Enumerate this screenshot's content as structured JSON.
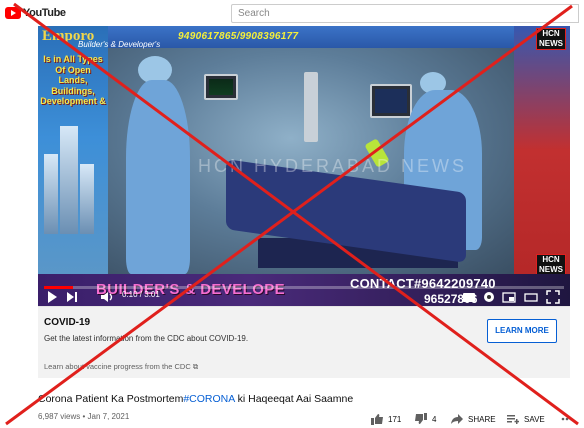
{
  "header": {
    "logo_text": "YouTube",
    "search_placeholder": "Search"
  },
  "video": {
    "ad_brand": "Emporo",
    "ad_brand_sub": "Builder's & Developer's",
    "ad_left_text": "Is in All Types Of Open Lands, Buildings, Development &",
    "top_phones": "9490617865/9908396177",
    "channel_logo": "HCN NEWS",
    "watermark": "HCN HYDERABAD NEWS",
    "lower_band_text": "BUILDER'S & DEVELOPE",
    "contact_line": "CONTACT#9642209740",
    "contact_line2": "96527806",
    "time_display": "0:10 / 3:01",
    "progress_fraction": 0.055
  },
  "info_panel": {
    "title": "COVID-19",
    "body": "Get the latest information from the CDC about COVID-19.",
    "button": "LEARN MORE",
    "link": "Learn about vaccine progress from the CDC ⧉"
  },
  "title": {
    "before": "Corona Patient Ka Postmortem",
    "hashtag": "#CORONA",
    "after": " ki Haqeeqat Aai Saamne"
  },
  "meta": {
    "views_date": "6,987 views • Jan 7, 2021"
  },
  "actions": {
    "likes": "171",
    "dislikes": "4",
    "share": "SHARE",
    "save": "SAVE"
  },
  "colors": {
    "youtube_red": "#ff0000",
    "link_blue": "#065fd4",
    "overlay_red": "#e0201c"
  }
}
